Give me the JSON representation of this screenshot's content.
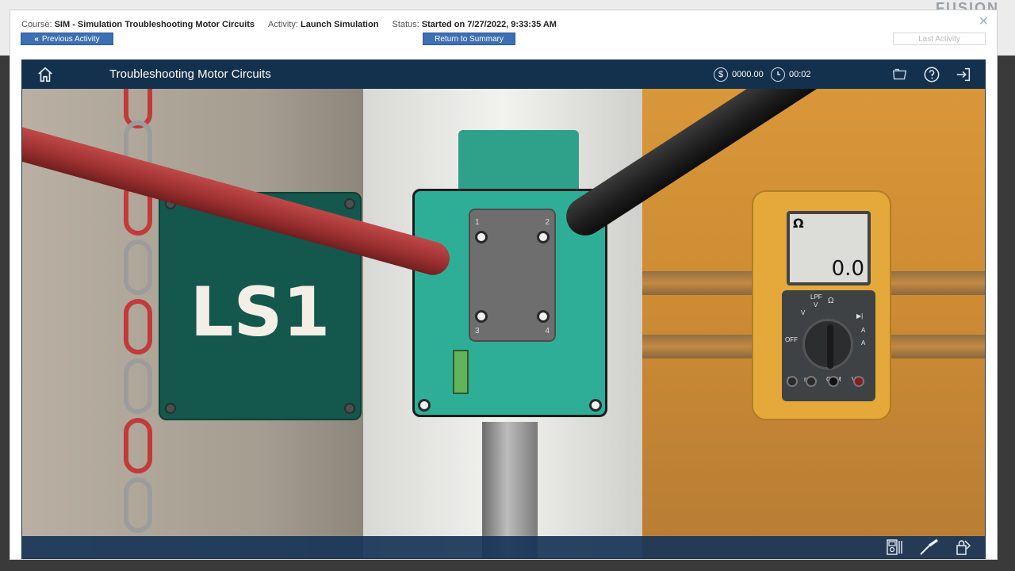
{
  "brand": "FUSION",
  "info": {
    "course_label": "Course:",
    "course_value": "SIM - Simulation Troubleshooting Motor Circuits",
    "activity_label": "Activity:",
    "activity_value": "Launch Simulation",
    "status_label": "Status:",
    "status_value": "Started on 7/27/2022, 9:33:35 AM"
  },
  "buttons": {
    "previous": "Previous Activity",
    "summary": "Return to Summary",
    "last": "Last Activity"
  },
  "sim": {
    "title": "Troubleshooting Motor Circuits",
    "money": "0000.00",
    "timer": "00:02"
  },
  "scene": {
    "sign_label": "LS1",
    "device_terminals": [
      "1",
      "2",
      "3",
      "4"
    ]
  },
  "meter": {
    "unit": "Ω",
    "reading": "0.0",
    "labels": {
      "lpf": "LPF",
      "ohm": "Ω",
      "off": "OFF",
      "v1": "V",
      "v2": "V",
      "a1": "A",
      "a2": "A",
      "amp": "A",
      "ma": "mA",
      "com": "COM",
      "vohm": "VΩ"
    }
  },
  "colors": {
    "header": "#13304d",
    "button": "#3d6fb4",
    "sign": "#14574d",
    "device": "#2fae97",
    "meter": "#e4a93a"
  }
}
